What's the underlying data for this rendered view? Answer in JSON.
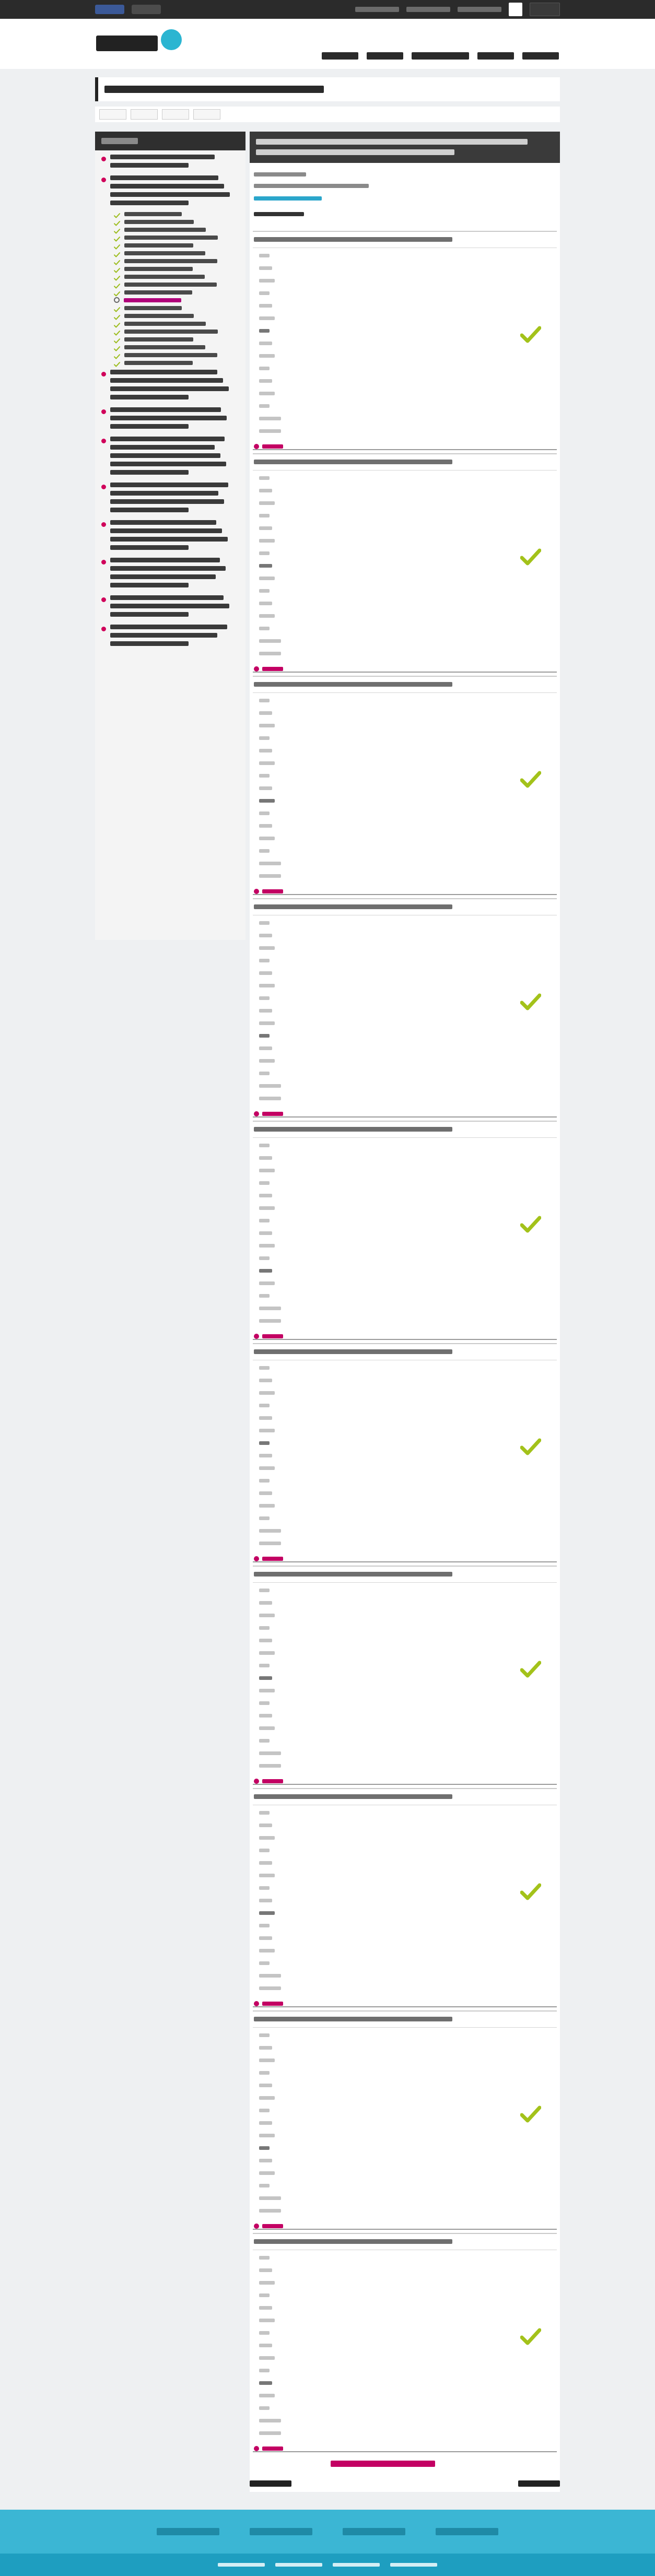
{
  "topbar": {},
  "header": {
    "logo": "miriada-logo",
    "nav": [
      {
        "label": ""
      },
      {
        "label": ""
      },
      {
        "label": ""
      },
      {
        "label": ""
      },
      {
        "label": ""
      }
    ]
  },
  "course": {
    "title": "",
    "tabs": [
      {
        "label": ""
      },
      {
        "label": ""
      },
      {
        "label": ""
      },
      {
        "label": ""
      }
    ]
  },
  "sidebar": {
    "title": "",
    "modules": [],
    "topics": []
  },
  "content": {
    "heading": "",
    "questions": []
  },
  "footer": {
    "partners": [],
    "links": []
  }
}
